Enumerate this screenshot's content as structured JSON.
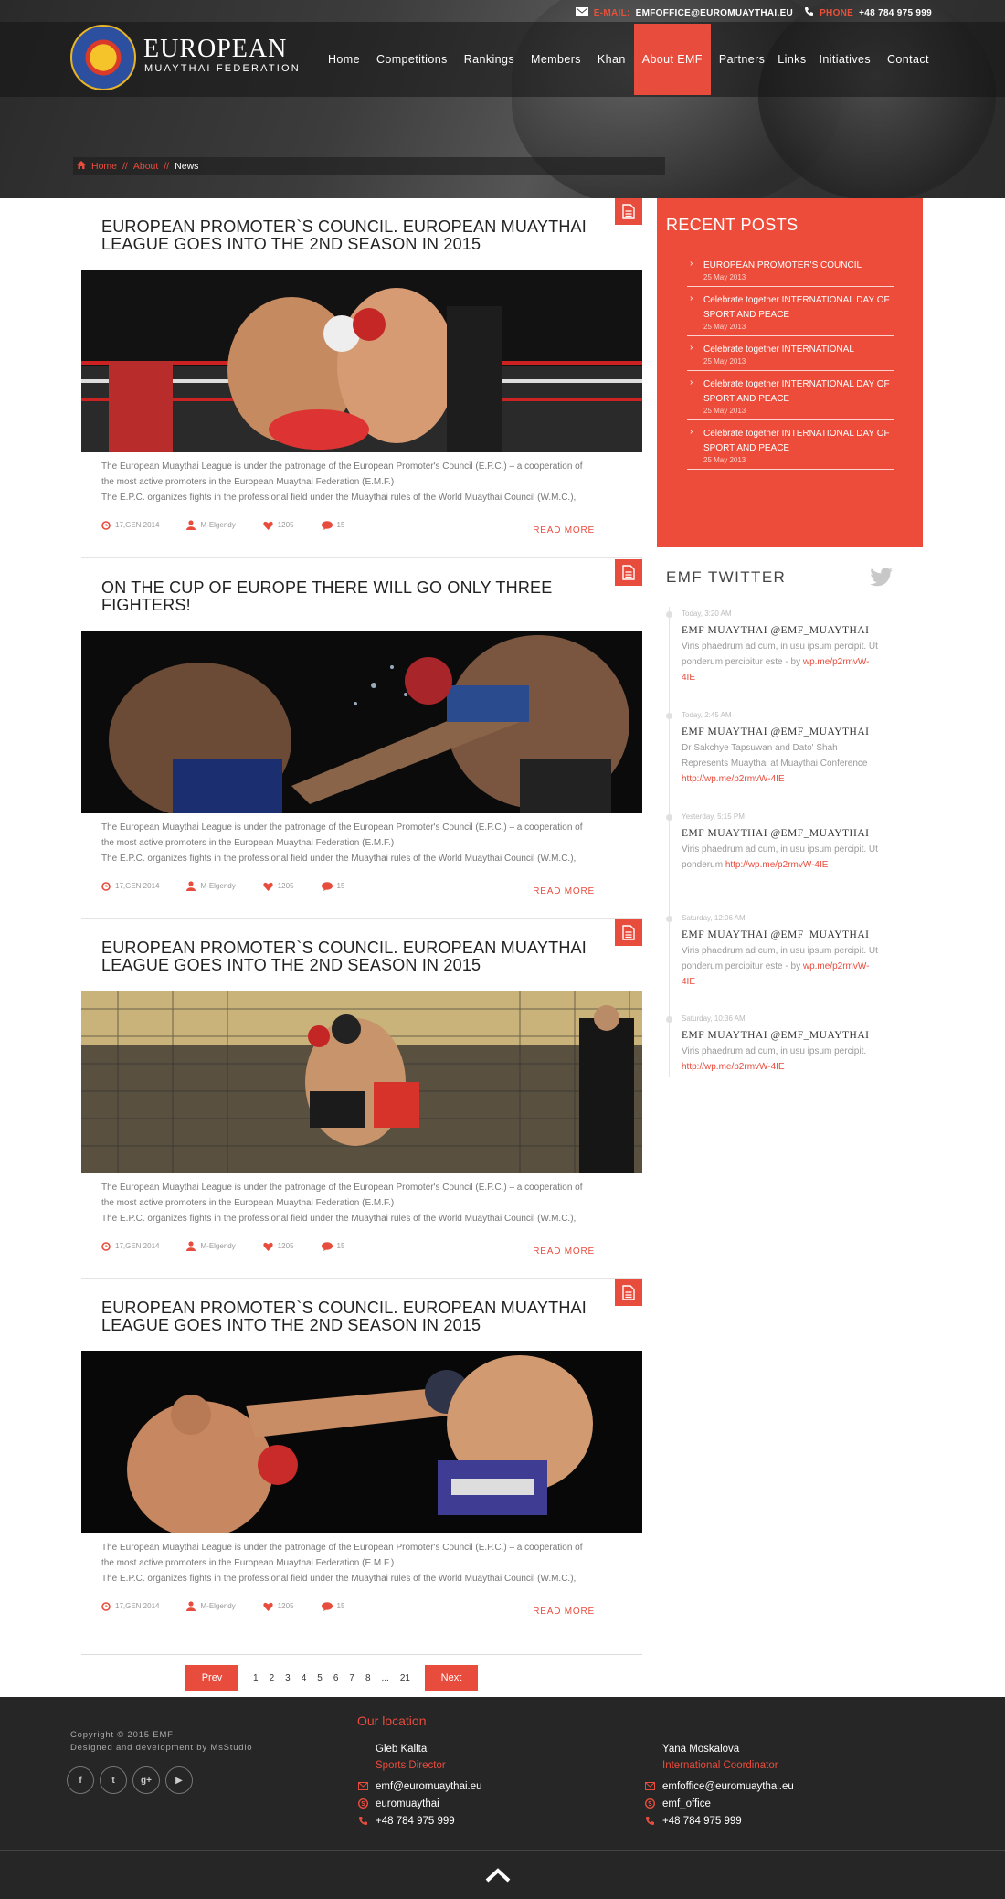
{
  "colors": {
    "accent": "#e84c3d",
    "header_dark": "#222222",
    "footer_bg": "#262626"
  },
  "topbar": {
    "email_label": "E-MAIL:",
    "email": "EMFOFFICE@EUROMUAYTHAI.EU",
    "phone_label": "PHONE",
    "phone": "+48 784 975 999"
  },
  "brand": {
    "line1": "EUROPEAN",
    "line2": "MUAYTHAI FEDERATION"
  },
  "nav": {
    "items": [
      {
        "label": "Home"
      },
      {
        "label": "Competitions"
      },
      {
        "label": "Rankings"
      },
      {
        "label": "Members"
      },
      {
        "label": "Khan"
      },
      {
        "label": "About EMF",
        "active": true
      },
      {
        "label": "Partners"
      },
      {
        "label": "Links"
      },
      {
        "label": "Initiatives"
      },
      {
        "label": "Contact"
      }
    ]
  },
  "breadcrumb": {
    "home": "Home",
    "sep": "//",
    "about": "About",
    "current": "News"
  },
  "posts": [
    {
      "title": "EUROPEAN PROMOTER`S COUNCIL. EUROPEAN MUAYTHAI LEAGUE GOES INTO THE 2ND SEASON IN 2015",
      "excerpt_line1": "The European Muaythai League is under the patronage of the European Promoter's Council (E.P.C.) – a cooperation of",
      "excerpt_line2": "the most active promoters in the European Muaythai Federation (E.M.F.)",
      "excerpt_line3": "The E.P.C. organizes fights in the professional field under the Muaythai rules of the World Muaythai Council (W.M.C.),",
      "date": "17,GEN 2014",
      "author": "M-Elgendy",
      "likes": "1205",
      "comments": "15",
      "read_more": "READ MORE"
    },
    {
      "title": "ON THE CUP OF EUROPE THERE WILL GO ONLY THREE FIGHTERS!",
      "excerpt_line1": "The European Muaythai League is under the patronage of the European Promoter's Council (E.P.C.) – a cooperation of",
      "excerpt_line2": "the most active promoters in the European Muaythai Federation (E.M.F.)",
      "excerpt_line3": "The E.P.C. organizes fights in the professional field under the Muaythai rules of the World Muaythai Council (W.M.C.),",
      "date": "17,GEN 2014",
      "author": "M-Elgendy",
      "likes": "1205",
      "comments": "15",
      "read_more": "READ MORE"
    },
    {
      "title": "EUROPEAN PROMOTER`S COUNCIL. EUROPEAN MUAYTHAI LEAGUE GOES INTO THE 2ND SEASON IN 2015",
      "excerpt_line1": "The European Muaythai League is under the patronage of the European Promoter's Council (E.P.C.) – a cooperation of",
      "excerpt_line2": "the most active promoters in the European Muaythai Federation (E.M.F.)",
      "excerpt_line3": "The E.P.C. organizes fights in the professional field under the Muaythai rules of the World Muaythai Council (W.M.C.),",
      "date": "17,GEN 2014",
      "author": "M-Elgendy",
      "likes": "1205",
      "comments": "15",
      "read_more": "READ MORE"
    },
    {
      "title": "EUROPEAN PROMOTER`S COUNCIL. EUROPEAN MUAYTHAI LEAGUE GOES INTO THE 2ND SEASON IN 2015",
      "excerpt_line1": "The European Muaythai League is under the patronage of the European Promoter's Council (E.P.C.) – a cooperation of",
      "excerpt_line2": "the most active promoters in the European Muaythai Federation (E.M.F.)",
      "excerpt_line3": "The E.P.C. organizes fights in the professional field under the Muaythai rules of the World Muaythai Council (W.M.C.),",
      "date": "17,GEN 2014",
      "author": "M-Elgendy",
      "likes": "1205",
      "comments": "15",
      "read_more": "READ MORE"
    }
  ],
  "recent": {
    "title": "RECENT POSTS",
    "items": [
      {
        "title": "EUROPEAN PROMOTER'S COUNCIL",
        "date": "25 May 2013"
      },
      {
        "title": "Celebrate together INTERNATIONAL DAY OF SPORT AND PEACE",
        "date": "25 May 2013"
      },
      {
        "title": "Celebrate together INTERNATIONAL",
        "date": "25 May 2013"
      },
      {
        "title": "Celebrate together INTERNATIONAL DAY OF SPORT AND PEACE",
        "date": "25 May 2013"
      },
      {
        "title": "Celebrate together INTERNATIONAL DAY OF SPORT AND PEACE",
        "date": "25 May 2013"
      }
    ]
  },
  "twitter": {
    "title": "EMF TWITTER",
    "tweets": [
      {
        "time": "Today, 3:20 AM",
        "user": "EMF MUAYTHAI @EMF_MUAYTHAI",
        "text": "Viris phaedrum ad cum, in usu ipsum percipit. Ut ponderum percipitur este - by",
        "link": "wp.me/p2rmvW-4IE"
      },
      {
        "time": "Today, 2:45 AM",
        "user": "EMF MUAYTHAI @EMF_MUAYTHAI",
        "text": "Dr Sakchye Tapsuwan and Dato' Shah Represents Muaythai at Muaythai Conference",
        "link": "http://wp.me/p2rmvW-4IE"
      },
      {
        "time": "Yesterday, 5:15 PM",
        "user": "EMF MUAYTHAI @EMF_MUAYTHAI",
        "text": "Viris phaedrum ad cum, in usu ipsum percipit. Ut ponderum",
        "link": "http://wp.me/p2rmvW-4IE"
      },
      {
        "time": "Saturday, 12:06 AM",
        "user": "EMF MUAYTHAI @EMF_MUAYTHAI",
        "text": "Viris phaedrum ad cum, in usu ipsum percipit. Ut ponderum percipitur este - by",
        "link": "wp.me/p2rmvW-4IE"
      },
      {
        "time": "Saturday, 10:36 AM",
        "user": "EMF MUAYTHAI @EMF_MUAYTHAI",
        "text": "Viris phaedrum ad cum, in usu ipsum percipit.",
        "link": "http://wp.me/p2rmvW-4IE"
      }
    ]
  },
  "pagination": {
    "prev": "Prev",
    "next": "Next",
    "pages": [
      "1",
      "2",
      "3",
      "4",
      "5",
      "6",
      "7",
      "8",
      "...",
      "21"
    ]
  },
  "footer": {
    "copyright": "Copyright © 2015 EMF",
    "credit": "Designed and development by MsStudio",
    "social": [
      {
        "icon": "facebook-icon",
        "glyph": "f"
      },
      {
        "icon": "twitter-icon",
        "glyph": "t"
      },
      {
        "icon": "google-plus-icon",
        "glyph": "g+"
      },
      {
        "icon": "youtube-icon",
        "glyph": "▶"
      }
    ],
    "location_title": "Our location",
    "contacts": [
      {
        "name": "Gleb Kallta",
        "role": "Sports Director",
        "email": "emf@euromuaythai.eu",
        "skype": "euromuaythai",
        "phone": "+48 784 975 999"
      },
      {
        "name": "Yana Moskalova",
        "role": "International Coordinator",
        "email": "emfoffice@euromuaythai.eu",
        "skype": "emf_office",
        "phone": "+48 784 975 999"
      }
    ]
  }
}
